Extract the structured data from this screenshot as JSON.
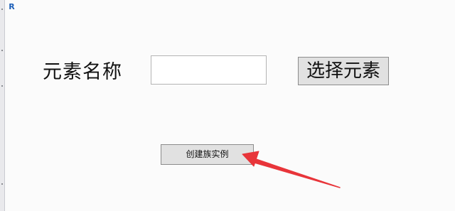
{
  "window": {
    "app_icon_glyph": "R"
  },
  "form": {
    "element_name_label": "元素名称",
    "element_name_value": "",
    "select_element_label": "选择元素",
    "create_family_instance_label": "创建族实例"
  },
  "annotation": {
    "arrow_color": "#e8353a"
  },
  "colors": {
    "button_background": "#e1e1e1",
    "button_border": "#8c8c8c",
    "window_background": "#fbfbfb"
  }
}
